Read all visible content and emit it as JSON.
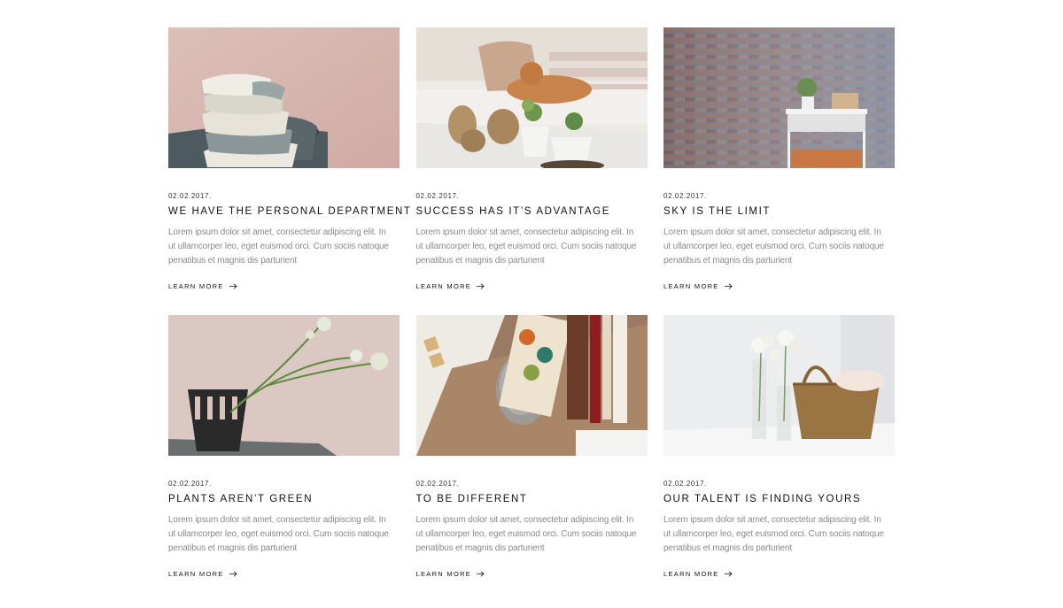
{
  "posts": [
    {
      "date": "02.02.2017.",
      "title": "We have the personal department",
      "excerpt": "Lorem ipsum dolor sit amet, consectetur adipiscing elit. In ut ullamcorper leo, eget euismod orci. Cum sociis natoque penatibus et magnis dis parturient",
      "link_label": "Learn more",
      "image": "stacked-bowls-photo"
    },
    {
      "date": "02.02.2017.",
      "title": "Success has it’s advantage",
      "excerpt": "Lorem ipsum dolor sit amet, consectetur adipiscing elit. In ut ullamcorper leo, eget euismod orci. Cum sociis natoque penatibus et magnis dis parturient",
      "link_label": "Learn more",
      "image": "cat-on-sofa-photo"
    },
    {
      "date": "02.02.2017.",
      "title": "Sky is the limit",
      "excerpt": "Lorem ipsum dolor sit amet, consectetur adipiscing elit. In ut ullamcorper leo, eget euismod orci. Cum sociis natoque penatibus et magnis dis parturient",
      "link_label": "Learn more",
      "image": "brick-wall-shelf-photo"
    },
    {
      "date": "02.02.2017.",
      "title": "Plants aren’t green",
      "excerpt": "Lorem ipsum dolor sit amet, consectetur adipiscing elit. In ut ullamcorper leo, eget euismod orci. Cum sociis natoque penatibus et magnis dis parturient",
      "link_label": "Learn more",
      "image": "black-vase-flower-photo"
    },
    {
      "date": "02.02.2017.",
      "title": "To be different",
      "excerpt": "Lorem ipsum dolor sit amet, consectetur adipiscing elit. In ut ullamcorper leo, eget euismod orci. Cum sociis natoque penatibus et magnis dis parturient",
      "link_label": "Learn more",
      "image": "brain-bookend-photo"
    },
    {
      "date": "02.02.2017.",
      "title": "Our talent is finding yours",
      "excerpt": "Lorem ipsum dolor sit amet, consectetur adipiscing elit. In ut ullamcorper leo, eget euismod orci. Cum sociis natoque penatibus et magnis dis parturient",
      "link_label": "Learn more",
      "image": "wicker-basket-flowers-photo"
    }
  ],
  "colors": {
    "background": "#ffffff",
    "title_text": "#111111",
    "excerpt_text": "#8a8a8a"
  }
}
